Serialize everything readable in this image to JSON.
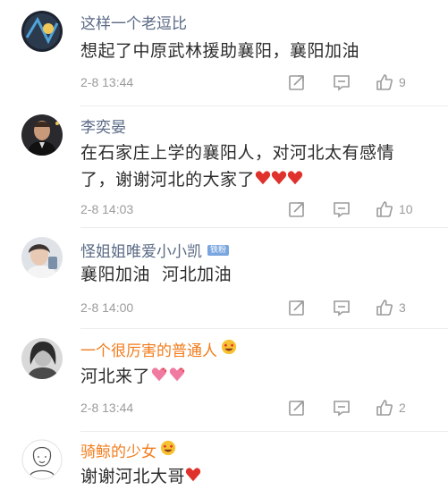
{
  "comments": [
    {
      "username": "这样一个老逗比",
      "text": "想起了中原武林援助襄阳，襄阳加油",
      "timestamp": "2-8 13:44",
      "likes": "9"
    },
    {
      "username": "李奕晏",
      "text": "在石家庄上学的襄阳人，对河北太有感情了，谢谢河北的大家了",
      "timestamp": "2-8 14:03",
      "likes": "10"
    },
    {
      "username": "怪姐姐唯爱小小凯",
      "badge": "铁粉",
      "text": "襄阳加油  河北加油",
      "timestamp": "2-8 14:00",
      "likes": "3"
    },
    {
      "username": "一个很厉害的普通人",
      "text": "河北来了",
      "timestamp": "2-8 13:44",
      "likes": "2"
    },
    {
      "username": "骑鲸的少女",
      "text": "谢谢河北大哥"
    }
  ],
  "colors": {
    "username": "#5a6a85",
    "vip_username": "#f27c1c",
    "heart": "#e0322c",
    "meta": "#9b9b9b"
  },
  "icons": [
    "share-icon",
    "reply-icon",
    "like-icon",
    "heart-icon",
    "heart-eyes-icon",
    "sparkling-heart-icon",
    "fan-badge"
  ]
}
